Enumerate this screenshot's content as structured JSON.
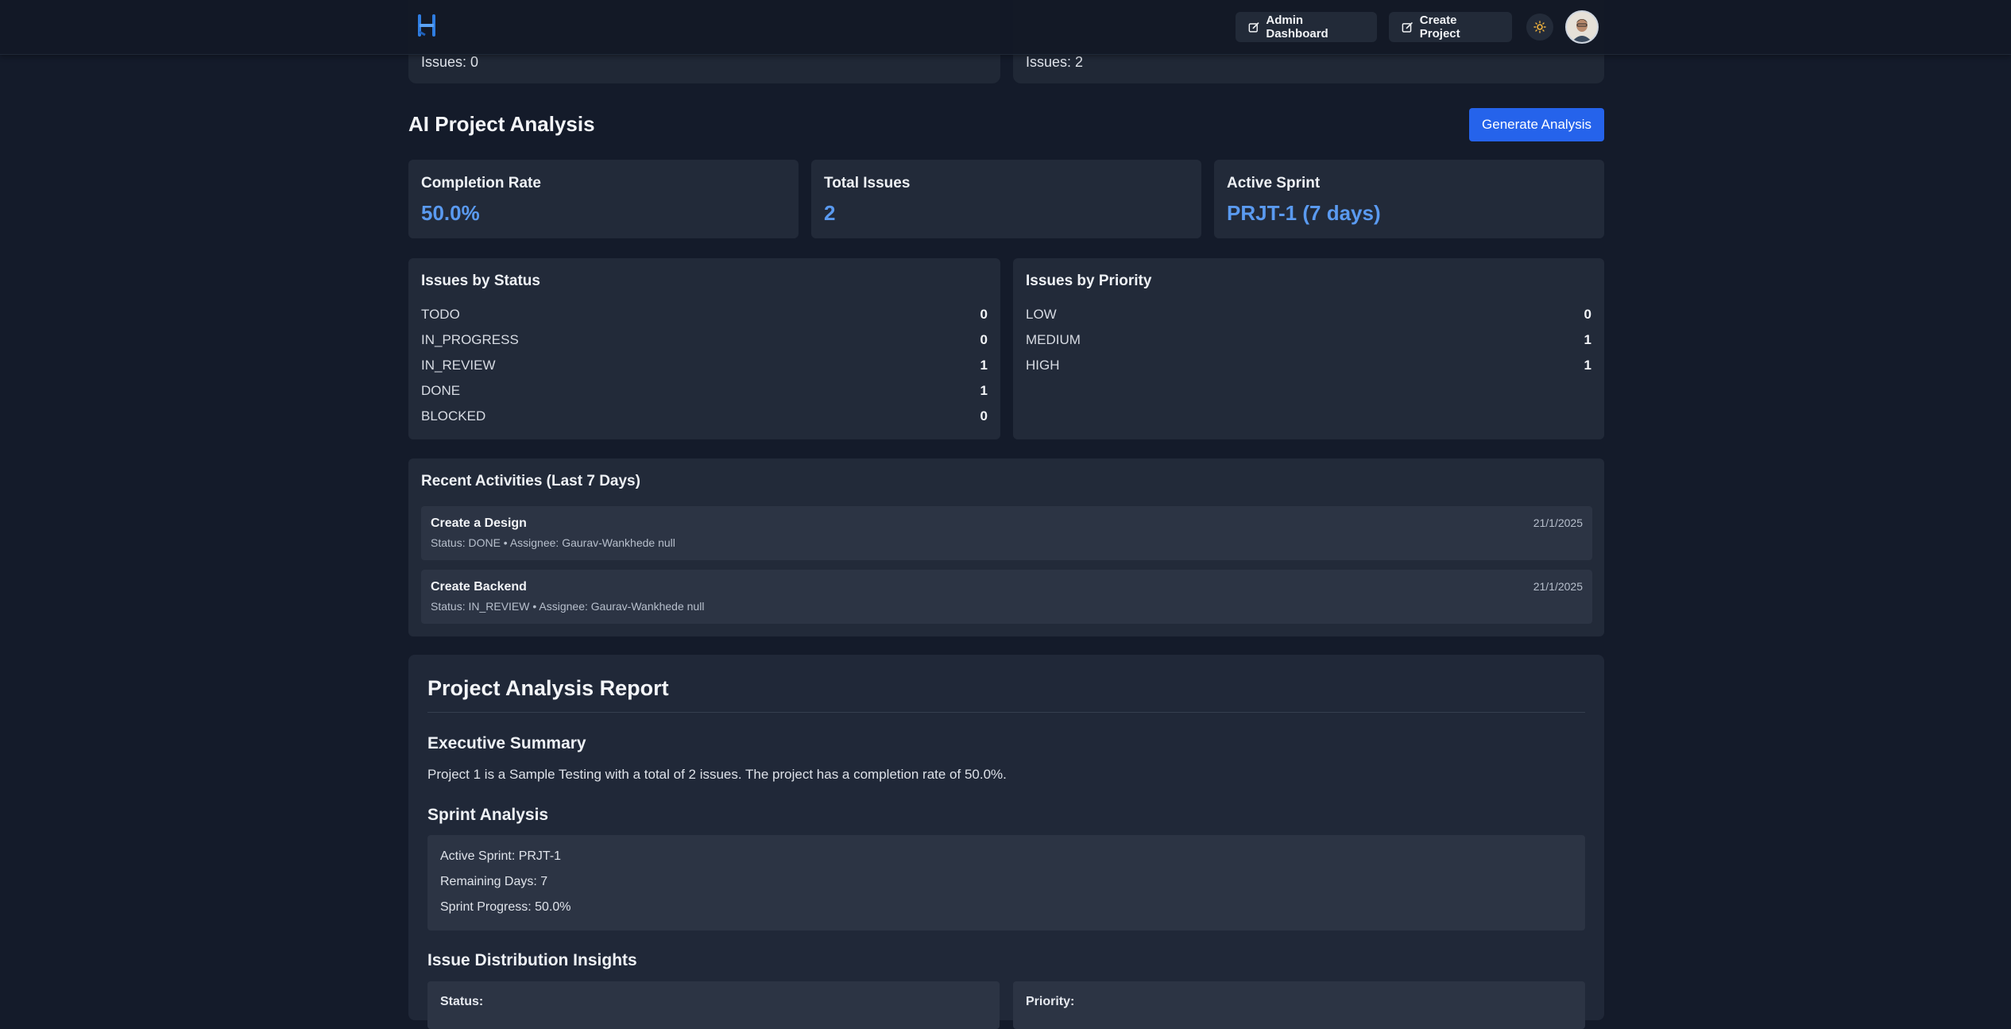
{
  "header": {
    "admin_dashboard": "Admin Dashboard",
    "create_project": "Create Project"
  },
  "peek_cards": [
    {
      "text": "Issues: 0"
    },
    {
      "text": "Issues: 2"
    }
  ],
  "analysis": {
    "title": "AI Project Analysis",
    "generate_button": "Generate Analysis",
    "stats": [
      {
        "label": "Completion Rate",
        "value": "50.0%"
      },
      {
        "label": "Total Issues",
        "value": "2"
      },
      {
        "label": "Active Sprint",
        "value": "PRJT-1 (7 days)"
      }
    ],
    "by_status": {
      "title": "Issues by Status",
      "rows": [
        {
          "label": "TODO",
          "value": "0"
        },
        {
          "label": "IN_PROGRESS",
          "value": "0"
        },
        {
          "label": "IN_REVIEW",
          "value": "1"
        },
        {
          "label": "DONE",
          "value": "1"
        },
        {
          "label": "BLOCKED",
          "value": "0"
        }
      ]
    },
    "by_priority": {
      "title": "Issues by Priority",
      "rows": [
        {
          "label": "LOW",
          "value": "0"
        },
        {
          "label": "MEDIUM",
          "value": "1"
        },
        {
          "label": "HIGH",
          "value": "1"
        }
      ]
    },
    "recent": {
      "title": "Recent Activities (Last 7 Days)",
      "items": [
        {
          "title": "Create a Design",
          "meta": "Status: DONE • Assignee: Gaurav-Wankhede null",
          "date": "21/1/2025"
        },
        {
          "title": "Create Backend",
          "meta": "Status: IN_REVIEW • Assignee: Gaurav-Wankhede null",
          "date": "21/1/2025"
        }
      ]
    }
  },
  "report": {
    "title": "Project Analysis Report",
    "executive_summary_title": "Executive Summary",
    "executive_summary_text": "Project 1 is a Sample Testing with a total of 2 issues. The project has a completion rate of 50.0%.",
    "sprint_title": "Sprint Analysis",
    "sprint_lines": [
      "Active Sprint: PRJT-1",
      "Remaining Days: 7",
      "Sprint Progress: 50.0%"
    ],
    "distribution_title": "Issue Distribution Insights",
    "distribution_status_label": "Status:",
    "distribution_priority_label": "Priority:"
  },
  "colors": {
    "accent": "#2563eb",
    "stat_value": "#5a9af0",
    "background": "#141b2a",
    "card": "#222a39"
  },
  "icons": [
    "logo-icon",
    "edit-icon",
    "sun-icon",
    "avatar"
  ]
}
